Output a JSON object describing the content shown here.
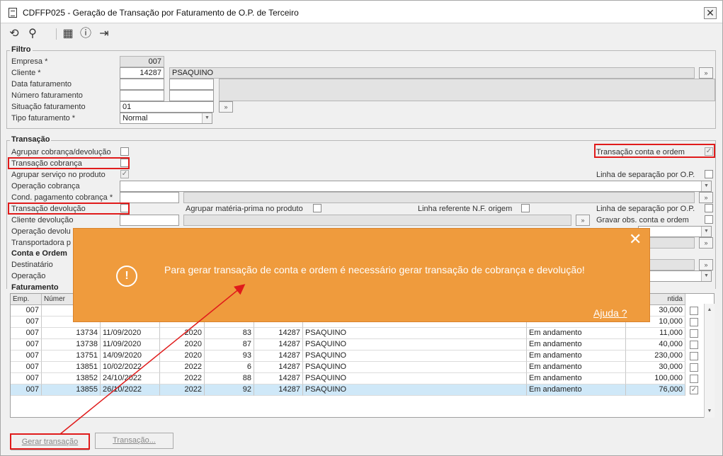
{
  "window": {
    "title": "CDFFP025 - Geração de Transação por Faturamento de O.P. de Terceiro",
    "close": "✕"
  },
  "filtro": {
    "title": "Filtro",
    "empresa_label": "Empresa *",
    "empresa": "007",
    "cliente_label": "Cliente *",
    "cliente_code": "14287",
    "cliente_name": "PSAQUINO",
    "data_label": "Data faturamento",
    "numero_label": "Número faturamento",
    "situacao_label": "Situação faturamento",
    "situacao": "01",
    "tipo_label": "Tipo faturamento *",
    "tipo": "Normal"
  },
  "transacao": {
    "title": "Transação",
    "agrupar_cob": "Agrupar cobrança/devolução",
    "transacao_conta": "Transação conta e ordem",
    "transacao_cobranca": "Transação cobrança",
    "agrupar_servico": "Agrupar serviço no produto",
    "linha_sep1": "Linha de separação por O.P.",
    "operacao_cobranca": "Operação cobrança",
    "cond_pagamento": "Cond. pagamento cobrança *",
    "transacao_devolucao": "Transação devolução",
    "agrupar_materia": "Agrupar matéria-prima no produto",
    "linha_ref": "Linha referente N.F. origem",
    "linha_sep2": "Linha de separação por O.P.",
    "cliente_devolucao": "Cliente devolução",
    "gravar_obs": "Gravar obs. conta e ordem",
    "operacao_devolucao": "Operação devolu",
    "transportadora": "Transportadora p"
  },
  "conta_ordem": {
    "title": "Conta e Ordem",
    "destinatario": "Destinatário",
    "operacao": "Operação"
  },
  "faturamento": {
    "title": "Faturamento",
    "head_emp": "Emp.",
    "head_num": "Númer",
    "head_qtd": "ntida",
    "rows": [
      {
        "emp": "007",
        "num": "",
        "date": "",
        "year": "",
        "op": "",
        "code": "",
        "name": "",
        "status": "",
        "qty": "30,000",
        "checked": false
      },
      {
        "emp": "007",
        "num": "",
        "date": "",
        "year": "",
        "op": "",
        "code": "",
        "name": "",
        "status": "",
        "qty": "10,000",
        "checked": false
      },
      {
        "emp": "007",
        "num": "13734",
        "date": "11/09/2020",
        "year": "2020",
        "op": "83",
        "code": "14287",
        "name": "PSAQUINO",
        "status": "Em andamento",
        "qty": "11,000",
        "checked": false
      },
      {
        "emp": "007",
        "num": "13738",
        "date": "11/09/2020",
        "year": "2020",
        "op": "87",
        "code": "14287",
        "name": "PSAQUINO",
        "status": "Em andamento",
        "qty": "40,000",
        "checked": false
      },
      {
        "emp": "007",
        "num": "13751",
        "date": "14/09/2020",
        "year": "2020",
        "op": "93",
        "code": "14287",
        "name": "PSAQUINO",
        "status": "Em andamento",
        "qty": "230,000",
        "checked": false
      },
      {
        "emp": "007",
        "num": "13851",
        "date": "10/02/2022",
        "year": "2022",
        "op": "6",
        "code": "14287",
        "name": "PSAQUINO",
        "status": "Em andamento",
        "qty": "30,000",
        "checked": false
      },
      {
        "emp": "007",
        "num": "13852",
        "date": "24/10/2022",
        "year": "2022",
        "op": "88",
        "code": "14287",
        "name": "PSAQUINO",
        "status": "Em andamento",
        "qty": "100,000",
        "checked": false
      },
      {
        "emp": "007",
        "num": "13855",
        "date": "26/10/2022",
        "year": "2022",
        "op": "92",
        "code": "14287",
        "name": "PSAQUINO",
        "status": "Em andamento",
        "qty": "76,000",
        "checked": true
      }
    ]
  },
  "buttons": {
    "gerar": "Gerar transação",
    "transacao": "Transação..."
  },
  "toast": {
    "message": "Para gerar transação de conta e ordem é necessário gerar transação de cobrança e devolução!",
    "help": "Ajuda ?",
    "close": "✕",
    "icon": "!"
  },
  "colors": {
    "toast": "#ef9b3d",
    "highlight": "#e01b1b",
    "selected_row": "#cfe8f8"
  }
}
